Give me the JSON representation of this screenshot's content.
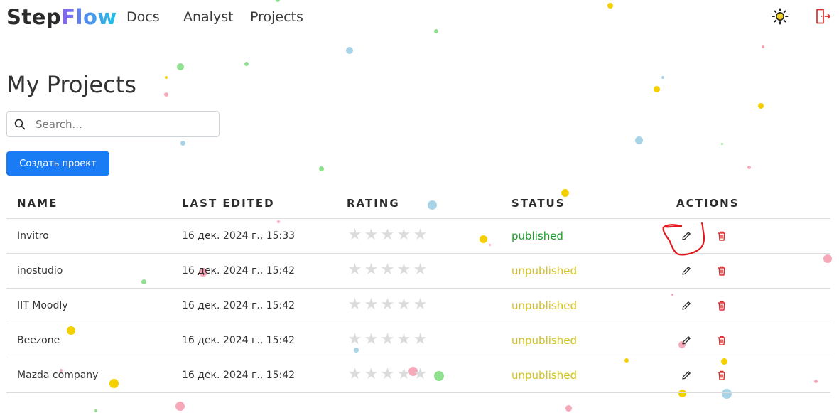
{
  "header": {
    "logo_part1": "Step",
    "logo_part2": "Flow",
    "nav": {
      "docs": "Docs",
      "analyst": "Analyst",
      "projects": "Projects"
    },
    "theme_icon": "sun-icon",
    "logout_icon": "logout-icon"
  },
  "page": {
    "title": "My Projects"
  },
  "search": {
    "placeholder": "Search...",
    "value": ""
  },
  "create_button": {
    "label": "Создать проект"
  },
  "table": {
    "columns": [
      "NAME",
      "LAST EDITED",
      "RATING",
      "STATUS",
      "ACTIONS"
    ],
    "rows": [
      {
        "name": "Invitro",
        "edited": "16 дек. 2024 г., 15:33",
        "rating": 0,
        "status": "published"
      },
      {
        "name": "inostudio",
        "edited": "16 дек. 2024 г., 15:42",
        "rating": 0,
        "status": "unpublished"
      },
      {
        "name": "IIT Moodly",
        "edited": "16 дек. 2024 г., 15:42",
        "rating": 0,
        "status": "unpublished"
      },
      {
        "name": "Beezone",
        "edited": "16 дек. 2024 г., 15:42",
        "rating": 0,
        "status": "unpublished"
      },
      {
        "name": "Mazda company",
        "edited": "16 дек. 2024 г., 15:42",
        "rating": 0,
        "status": "unpublished"
      }
    ],
    "max_rating": 5,
    "star_glyph": "★",
    "edit_icon": "pencil-icon",
    "delete_icon": "trash-icon"
  },
  "colors": {
    "accent": "#1a7cf5",
    "published": "#1e9e2a",
    "unpublished": "#d2c21a",
    "delete": "#d93030",
    "annotation": "#e0191f",
    "star_empty": "#dcdcdc"
  }
}
